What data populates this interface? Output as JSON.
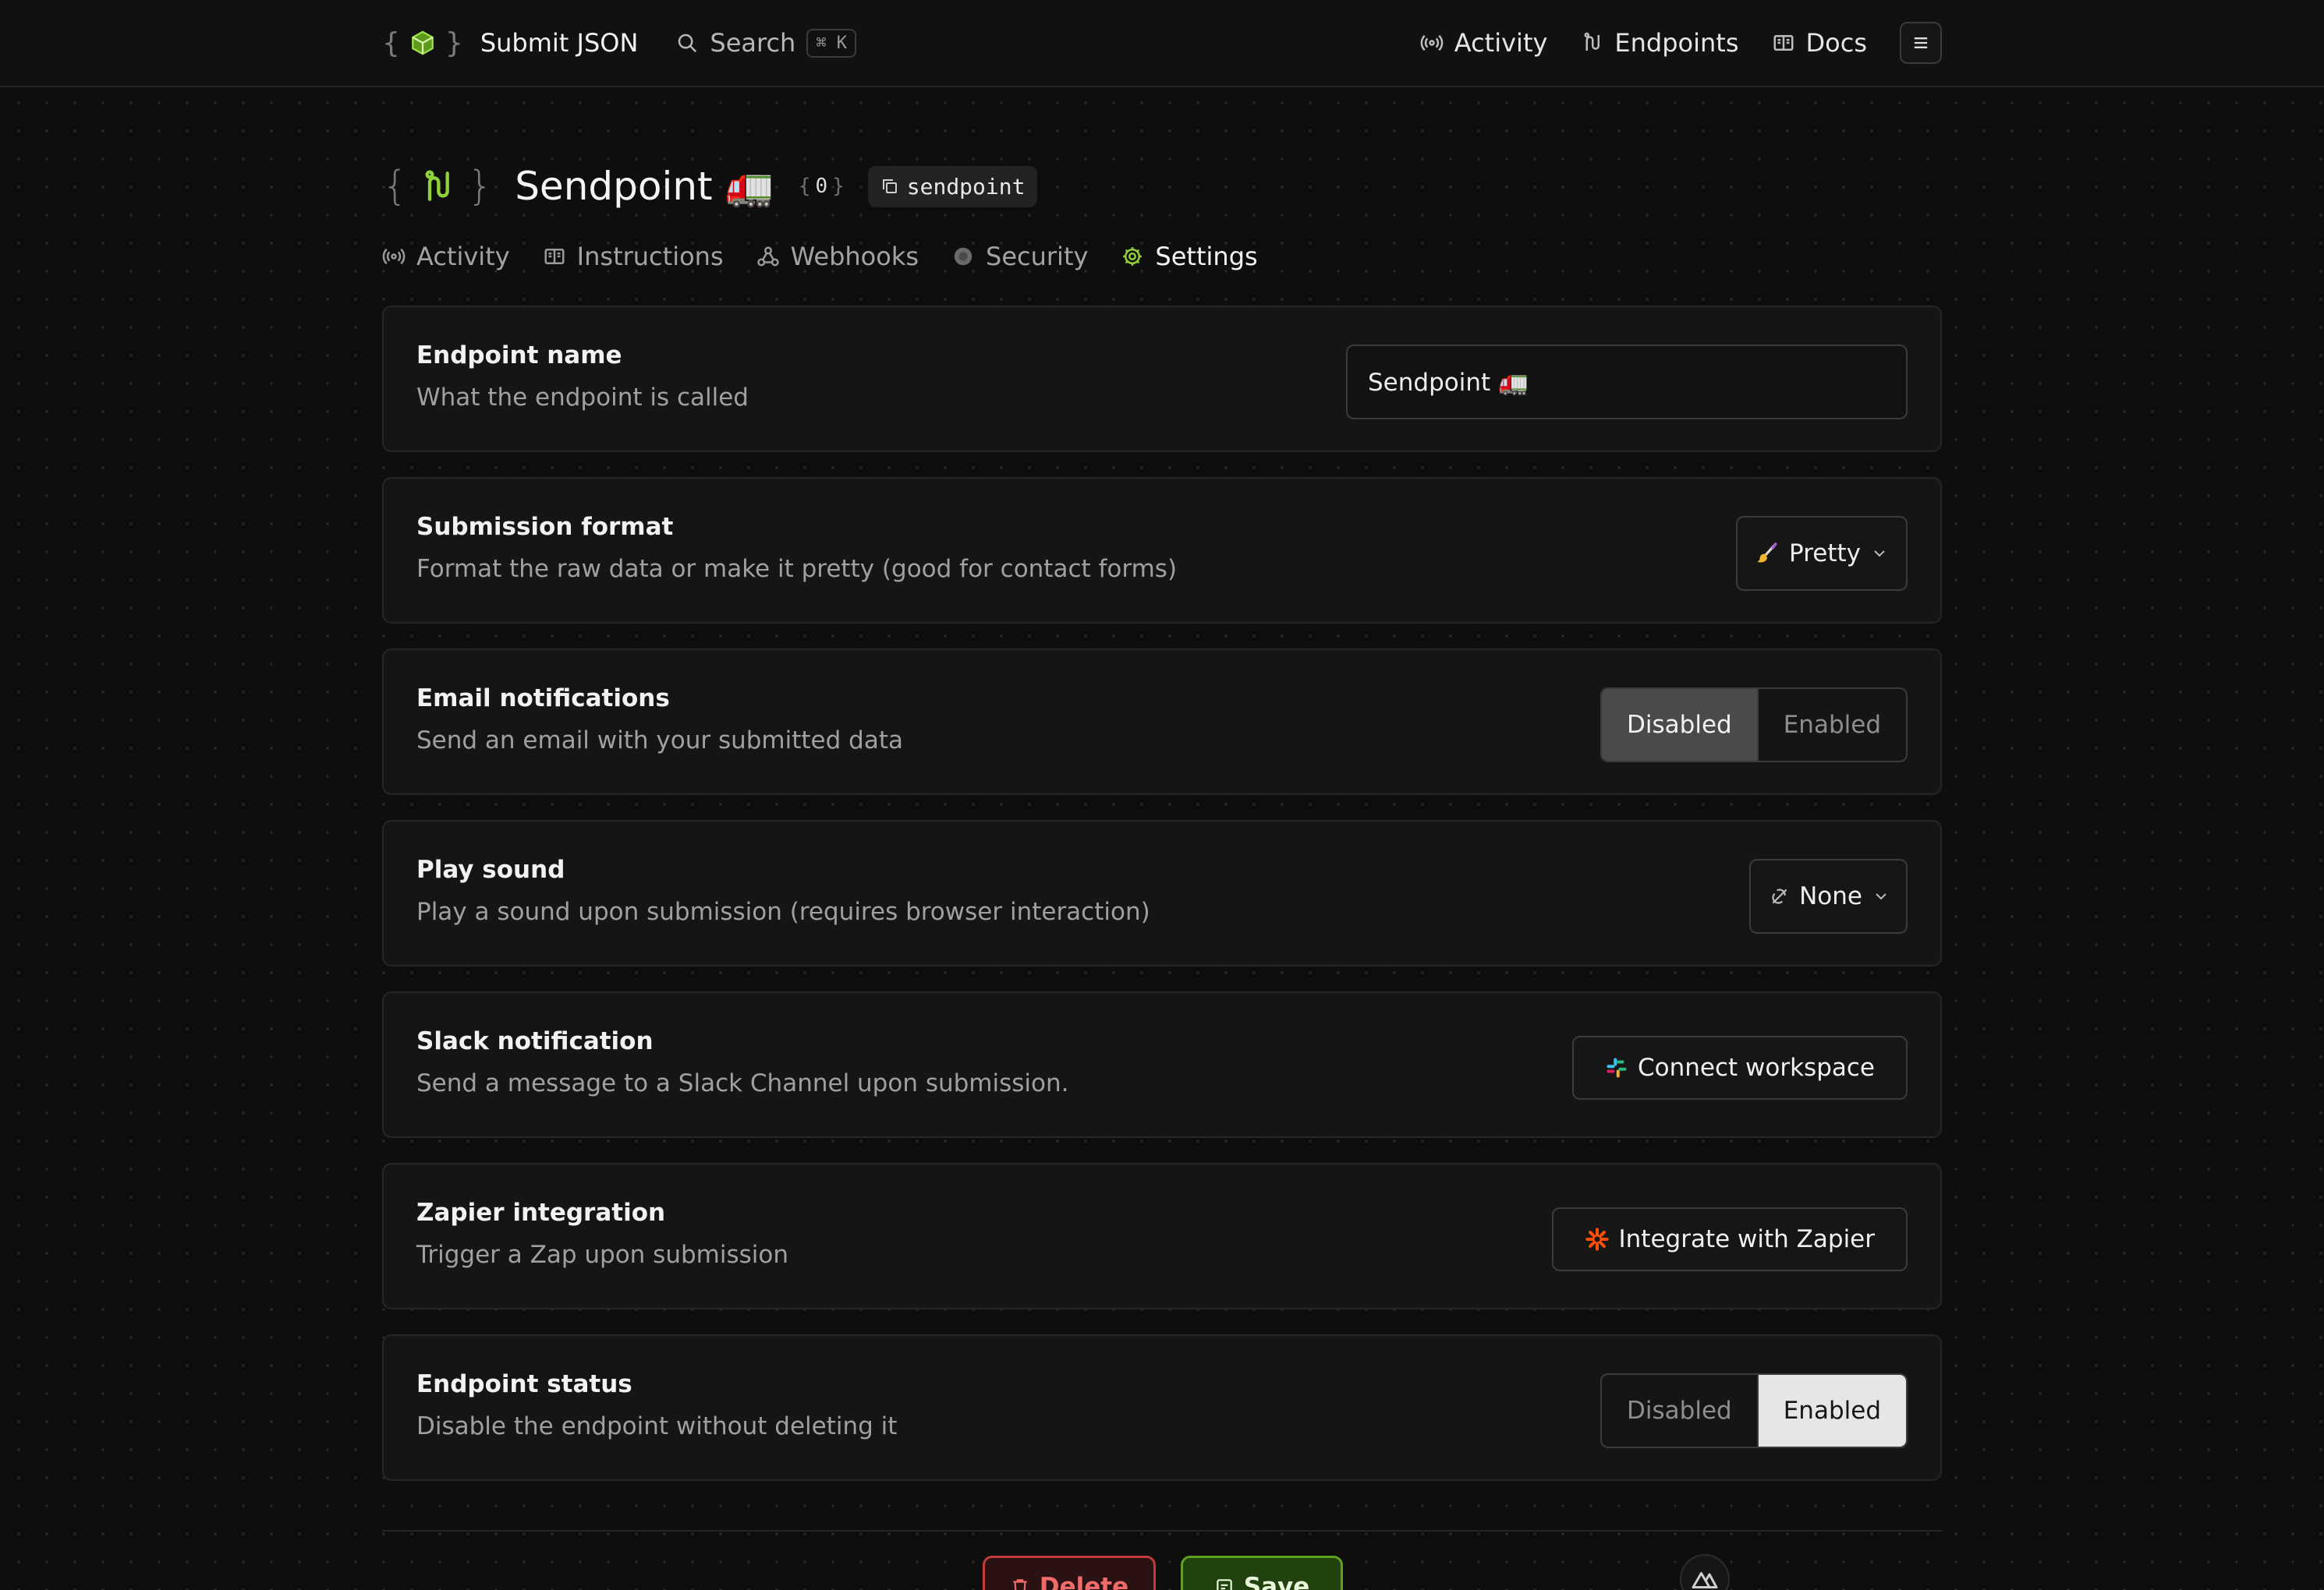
{
  "topnav": {
    "brand_title": "Submit JSON",
    "search_label": "Search",
    "search_shortcut": "⌘ K",
    "links": [
      {
        "label": "Activity",
        "icon": "broadcast-icon"
      },
      {
        "label": "Endpoints",
        "icon": "endpoints-icon"
      },
      {
        "label": "Docs",
        "icon": "book-icon"
      }
    ],
    "menu_icon": "hamburger-menu-icon"
  },
  "endpoint": {
    "name": "Sendpoint 🚛",
    "submission_count": "0",
    "slug": "sendpoint"
  },
  "tabs": [
    {
      "label": "Activity",
      "icon": "broadcast-icon",
      "active": false
    },
    {
      "label": "Instructions",
      "icon": "book-icon",
      "active": false
    },
    {
      "label": "Webhooks",
      "icon": "webhook-icon",
      "active": false
    },
    {
      "label": "Security",
      "icon": "shield-icon",
      "active": false
    },
    {
      "label": "Settings",
      "icon": "gear-icon",
      "active": true
    }
  ],
  "settings": {
    "endpoint_name": {
      "label": "Endpoint name",
      "description": "What the endpoint is called",
      "value": "Sendpoint 🚛"
    },
    "submission_format": {
      "label": "Submission format",
      "description": "Format the raw data or make it pretty (good for contact forms)",
      "selected": "Pretty",
      "icon": "paintbrush-icon"
    },
    "email_notifications": {
      "label": "Email notifications",
      "description": "Send an email with your submitted data",
      "options": [
        "Disabled",
        "Enabled"
      ],
      "selected": "Disabled"
    },
    "play_sound": {
      "label": "Play sound",
      "description": "Play a sound upon submission (requires browser interaction)",
      "selected": "None",
      "icon": "sound-off-icon"
    },
    "slack_notification": {
      "label": "Slack notification",
      "description": "Send a message to a Slack Channel upon submission.",
      "button_label": "Connect workspace",
      "icon": "slack-icon"
    },
    "zapier_integration": {
      "label": "Zapier integration",
      "description": "Trigger a Zap upon submission",
      "button_label": "Integrate with Zapier",
      "icon": "zapier-icon"
    },
    "endpoint_status": {
      "label": "Endpoint status",
      "description": "Disable the endpoint without deleting it",
      "options": [
        "Disabled",
        "Enabled"
      ],
      "selected": "Enabled"
    }
  },
  "actions": {
    "delete_label": "Delete",
    "save_label": "Save"
  },
  "colors": {
    "accent_green": "#8fd13a",
    "delete_red": "#c23b3b",
    "save_green": "#5fa020",
    "background": "#0e0e0e",
    "card": "#151515"
  }
}
